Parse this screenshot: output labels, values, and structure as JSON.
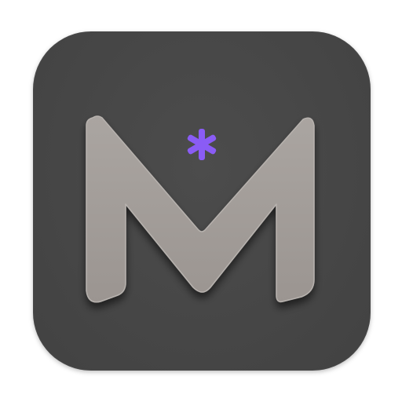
{
  "icon": {
    "name": "M* app icon",
    "glyph": "M",
    "mark": "*"
  },
  "colors": {
    "background": "#ffffff",
    "tile": "#464646",
    "letter": "#a29c98",
    "letter_shadow": "#2a2a2a",
    "accent": "#8a5cf5"
  }
}
